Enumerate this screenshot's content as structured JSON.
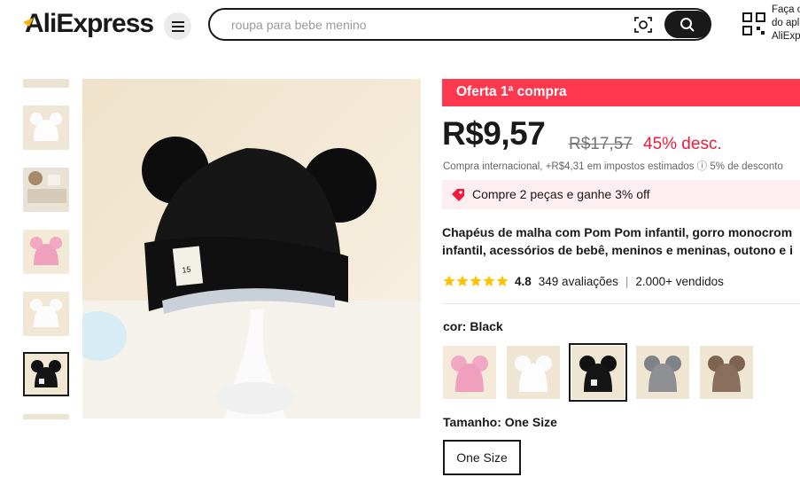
{
  "header": {
    "logo_text": "AliExpress",
    "search_placeholder": "roupa para bebe menino",
    "app_promo": [
      "Faça o",
      "do apl",
      "AliExpr"
    ]
  },
  "product": {
    "offer_banner": "Oferta 1ª compra",
    "price": "R$9,57",
    "old_price": "R$17,57",
    "discount": "45% desc.",
    "tax_note": "Compra internacional, +R$4,31 em impostos estimados ⓘ 5% de desconto",
    "promo": "Compre 2 peças e ganhe 3% off",
    "title_line1": "Chapéus de malha com Pom Pom infantil, gorro monocrom",
    "title_line2": "infantil, acessórios de bebê, meninos e meninas, outono e i",
    "rating": "4.8",
    "stars": 5,
    "reviews": "349 avaliações",
    "sold": "2.000+ vendidos",
    "color_label": "cor: Black",
    "colors": [
      {
        "name": "Pink",
        "hex": "#e9a6c2"
      },
      {
        "name": "White",
        "hex": "#f2f0ec"
      },
      {
        "name": "Black",
        "hex": "#151515"
      },
      {
        "name": "Gray",
        "hex": "#8d8f93"
      },
      {
        "name": "Brown",
        "hex": "#8a705c"
      }
    ],
    "size_label": "Tamanho: One Size",
    "size_option": "One Size"
  },
  "colors": {
    "accent": "#fd384f",
    "discount": "#ee1b39",
    "star": "#ffc200"
  }
}
